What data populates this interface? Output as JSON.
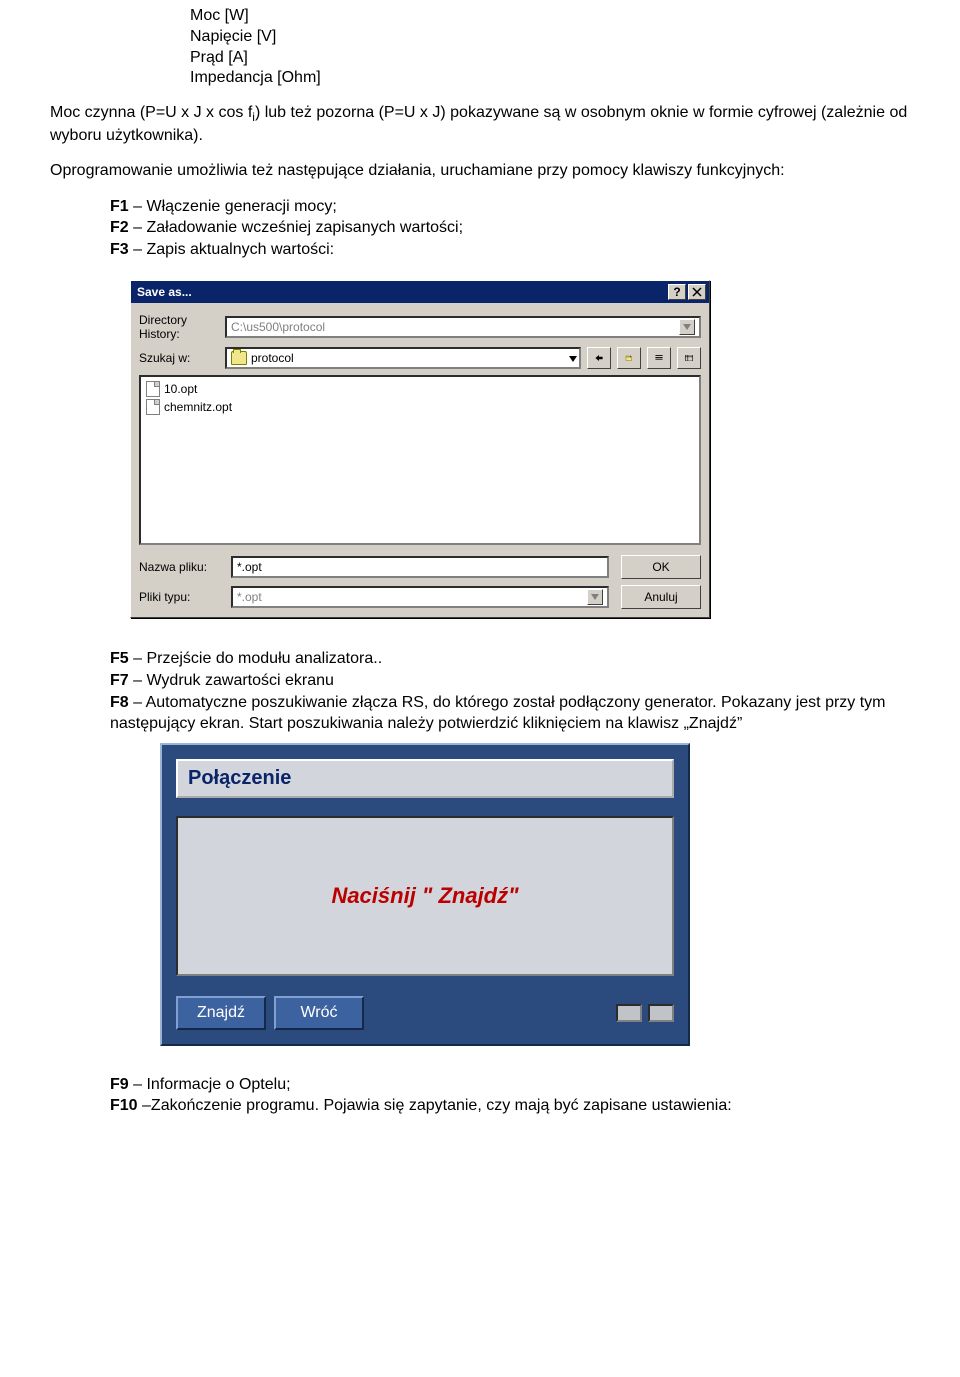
{
  "list": {
    "l1": "Moc [W]",
    "l2": "Napięcie [V]",
    "l3": "Prąd [A]",
    "l4": "Impedancja [Ohm]"
  },
  "p1_a": "Moc czynna (P=U x J x cos f",
  "p1_sub": "i",
  "p1_b": ") lub też pozorna (P=U x J) pokazywane są w osobnym oknie w formie cyfrowej (zależnie od wyboru użytkownika).",
  "p2": "Oprogramowanie umożliwia też następujące działania, uruchamiane przy pomocy klawiszy funkcyjnych:",
  "fkeys1": {
    "f1_k": "F1",
    "f1_t": " – Włączenie generacji mocy;",
    "f2_k": "F2",
    "f2_t": " – Załadowanie wcześniej zapisanych wartości;",
    "f3_k": "F3",
    "f3_t": " – Zapis aktualnych wartości:"
  },
  "save_dialog": {
    "title": "Save as...",
    "dir_label_1": "Directory",
    "dir_label_2": "History:",
    "dir_value": "C:\\us500\\protocol",
    "lookin_label": "Szukaj w:",
    "lookin_value": "protocol",
    "files": {
      "f0": "10.opt",
      "f1": "chemnitz.opt"
    },
    "name_label": "Nazwa pliku:",
    "name_value": "*.opt",
    "type_label": "Pliki typu:",
    "type_value": "*.opt",
    "ok": "OK",
    "cancel": "Anuluj"
  },
  "fkeys2": {
    "f5_k": "F5",
    "f5_t": " – Przejście do modułu analizatora..",
    "f7_k": "F7",
    "f7_t": " – Wydruk zawartości ekranu",
    "f8_k": "F8",
    "f8_t": " – Automatyczne poszukiwanie złącza RS, do którego został podłączony generator. Pokazany jest przy tym następujący ekran. Start poszukiwania należy potwierdzić kliknięciem na klawisz „Znajdź”"
  },
  "conn": {
    "title": "Połączenie",
    "msg": "Naciśnij \" Znajdź\"",
    "find": "Znajdź",
    "back": "Wróć"
  },
  "fkeys3": {
    "f9_k": "F9",
    "f9_t": " – Informacje o Optelu;",
    "f10_k": "F10",
    "f10_t": " –Zakończenie programu. Pojawia się zapytanie, czy mają być zapisane ustawienia:"
  }
}
